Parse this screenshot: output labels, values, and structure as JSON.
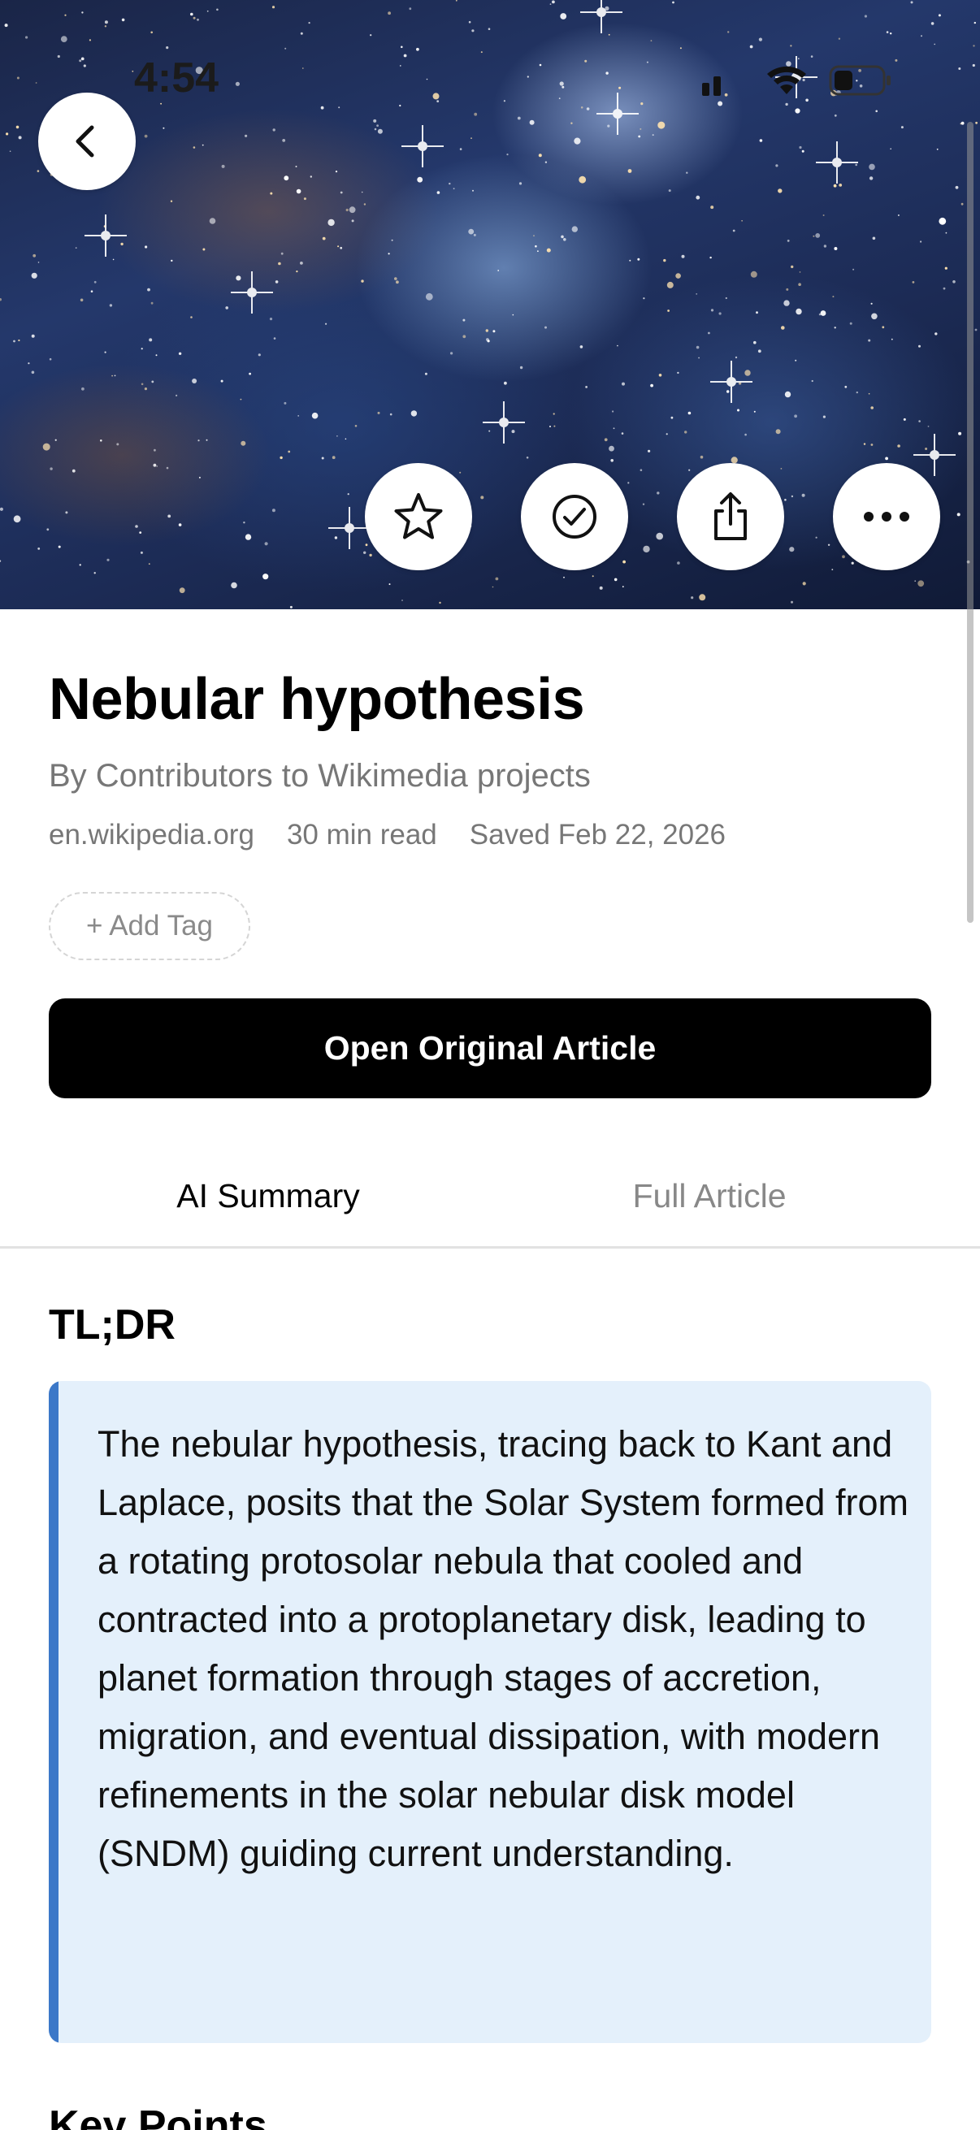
{
  "status_bar": {
    "time": "4:54"
  },
  "header_actions": {
    "back": "chevron-left-icon",
    "favorite": "star-icon",
    "mark_read": "checkmark-circle-icon",
    "share": "share-icon",
    "more": "ellipsis-icon"
  },
  "article": {
    "title": "Nebular hypothesis",
    "byline": "By Contributors to Wikimedia projects",
    "source": "en.wikipedia.org",
    "read_time": "30 min read",
    "saved": "Saved Feb 22, 2026",
    "add_tag_label": "+ Add Tag",
    "open_button_label": "Open Original Article"
  },
  "tabs": [
    {
      "label": "AI Summary",
      "active": true
    },
    {
      "label": "Full Article",
      "active": false
    }
  ],
  "summary": {
    "heading": "TL;DR",
    "text": "The nebular hypothesis, tracing back to Kant and Laplace, posits that the Solar System formed from a rotating protosolar nebula that cooled and contracted into a protoplanetary disk, leading to planet formation through stages of accretion, migration, and eventual dissipation, with modern refinements in the solar nebular disk model (SNDM) guiding current understanding.",
    "accent_color": "#3c78c8",
    "background_color": "#e4f0fb"
  },
  "key_points": {
    "heading": "Key Points"
  }
}
